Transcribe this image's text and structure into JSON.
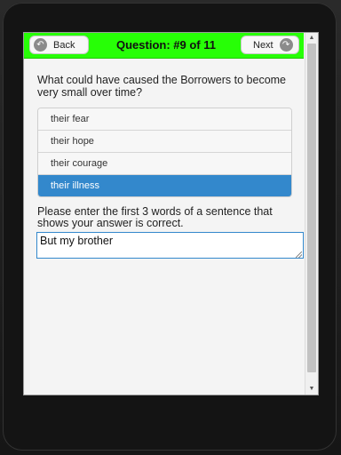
{
  "header": {
    "back_label": "Back",
    "next_label": "Next",
    "title": "Question: #9 of 11",
    "back_icon": "↶",
    "next_icon": "↷"
  },
  "question": {
    "text": "What could have caused the Borrowers to become very small over time?",
    "choices": [
      {
        "label": "their fear",
        "selected": false
      },
      {
        "label": "their hope",
        "selected": false
      },
      {
        "label": "their courage",
        "selected": false
      },
      {
        "label": "their illness",
        "selected": true
      }
    ]
  },
  "evidence": {
    "prompt": "Please enter the first 3 words of a sentence that shows your answer is correct.",
    "value": "But my brother"
  },
  "colors": {
    "header_bg": "#27ff06",
    "selected_bg": "#3388cc"
  },
  "icons": {
    "back": "back-arrow-icon",
    "next": "forward-arrow-icon"
  }
}
